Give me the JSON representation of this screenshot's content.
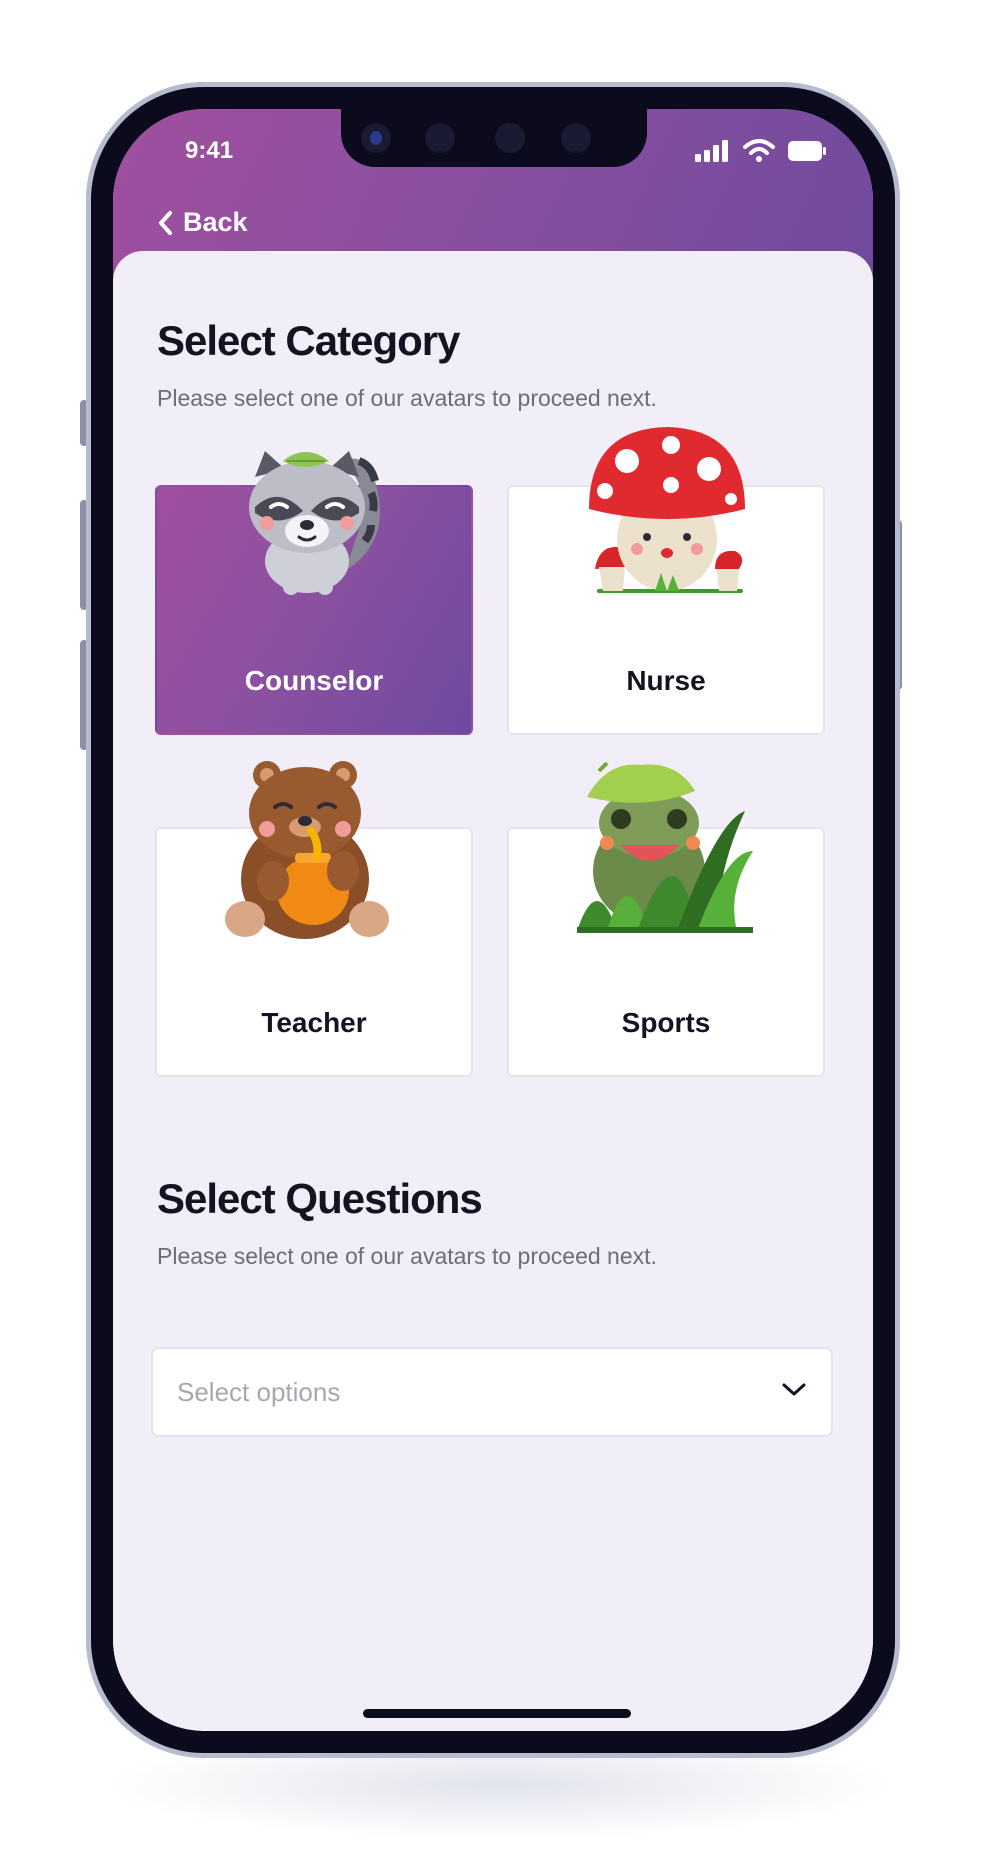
{
  "status_bar": {
    "time": "9:41"
  },
  "nav": {
    "back_label": "Back"
  },
  "category_section": {
    "title": "Select Category",
    "subtitle": "Please select one of our avatars to proceed next.",
    "cards": [
      {
        "label": "Counselor",
        "avatar": "raccoon",
        "selected": true
      },
      {
        "label": "Nurse",
        "avatar": "mushroom",
        "selected": false
      },
      {
        "label": "Teacher",
        "avatar": "bear-with-honey",
        "selected": false
      },
      {
        "label": "Sports",
        "avatar": "frog-in-grass",
        "selected": false
      }
    ]
  },
  "questions_section": {
    "title": "Select Questions",
    "subtitle": "Please select one of our avatars to proceed next.",
    "dropdown": {
      "placeholder": "Select options",
      "icon": "chevron-down-icon"
    }
  },
  "colors": {
    "accent_start": "#a04f9f",
    "accent_end": "#6f4a9e",
    "background": "#f1eef8"
  }
}
